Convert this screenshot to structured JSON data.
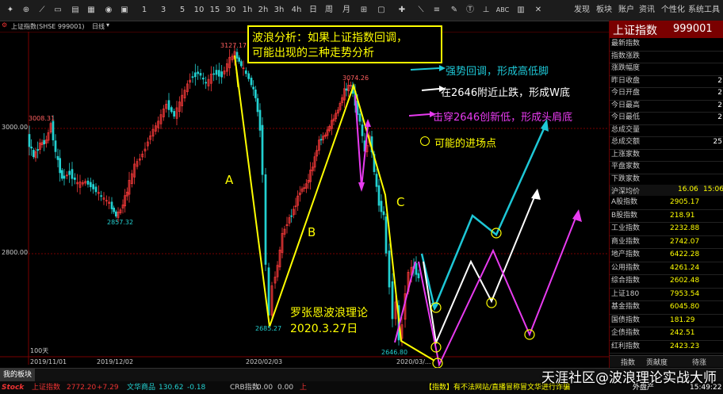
{
  "toolbar": {
    "left_items": [
      "5",
      "10",
      "15",
      "30",
      "1h",
      "2h",
      "3h",
      "4h",
      "日",
      "周",
      "月"
    ],
    "periods_1": [
      "1",
      "3",
      "5"
    ],
    "right_abc": "ABC",
    "menu": [
      "发现",
      "板块",
      "账户",
      "资讯",
      "个性化",
      "系统工具"
    ]
  },
  "chart_header": {
    "index_name": "上证指数(SHSE 999001)",
    "period": "日线"
  },
  "chart_data": {
    "type": "candlestick",
    "y_axis_ticks": [
      "3000.00",
      "2800.00"
    ],
    "x_axis_ticks": [
      "2019/11/01",
      "2019/12/02",
      "2020/02/03",
      "2020/03/02",
      "2020/03/..."
    ],
    "price_labels": [
      "3127.17",
      "3074.26",
      "3008.31",
      "2857.32",
      "2685.27",
      "2646.80"
    ],
    "wave_labels": [
      "A",
      "B",
      "C"
    ],
    "volume_note": "100天"
  },
  "annotations": {
    "title_box_line1": "波浪分析：如果上证指数回调，",
    "title_box_line2": "可能出现的三种走势分析",
    "legend_cyan": "强势回调，形成高低脚",
    "legend_white": "在2646附近止跌，形成W底",
    "legend_magenta": "击穿2646创新低，形成头肩底",
    "legend_circle": "可能的进场点",
    "author_line1": "罗张恩波浪理论",
    "author_line2": "2020.3.27日"
  },
  "info_panel": {
    "title": "上证指数",
    "code": "999001",
    "fields": [
      "最新指数",
      "指数涨跌",
      "涨跌幅度",
      "昨日收盘",
      "今日开盘",
      "今日最高",
      "今日最低",
      "总成交量",
      "总成交额",
      "上涨家数",
      "平盘家数",
      "下跌家数"
    ],
    "partial_values": [
      "2",
      "2",
      "2",
      "2",
      "25"
    ],
    "hs_label": "沪深均价",
    "hs_value": "16.06",
    "hs_time": "15:06",
    "stocks": [
      {
        "name": "A股指数",
        "value": "2905.17"
      },
      {
        "name": "B股指数",
        "value": "218.91"
      },
      {
        "name": "工业指数",
        "value": "2232.88"
      },
      {
        "name": "商业指数",
        "value": "2742.07"
      },
      {
        "name": "地产指数",
        "value": "6422.28"
      },
      {
        "name": "公用指数",
        "value": "4261.24"
      },
      {
        "name": "综合指数",
        "value": "2602.48"
      },
      {
        "name": "上证180",
        "value": "7953.54"
      },
      {
        "name": "基金指数",
        "value": "6045.80"
      },
      {
        "name": "国债指数",
        "value": "181.29"
      },
      {
        "name": "企债指数",
        "value": "242.51"
      },
      {
        "name": "红利指数",
        "value": "2423.23"
      }
    ],
    "tabs": [
      "指数",
      "贡献度",
      "待涨"
    ]
  },
  "bottom": {
    "tab": "我的板块",
    "ticker1_name": "上证指数",
    "ticker1_value": "2772.20",
    "ticker1_change": "+7.29",
    "ticker2_name": "文华商品",
    "ticker2_value": "130.62",
    "ticker2_change": "-0.18",
    "ticker3_name": "CRB指数",
    "ticker3_value": "0.00",
    "ticker3_change": "0.00",
    "ticker4_name": "上",
    "news": "【指数】有不法网站/直播冒称冒文华进行诈骗",
    "status_right": "外盘产",
    "time": "15:49:22",
    "logo": "Stock",
    "watermark": "天涯社区@波浪理论实战大师"
  },
  "colors": {
    "up": "#ff3b3b",
    "down": "#23d1d1",
    "yellow": "#ffff00",
    "cyan": "#1ec7d6",
    "magenta": "#e83bf0",
    "white": "#ffffff",
    "panel_red": "#7a0000"
  }
}
